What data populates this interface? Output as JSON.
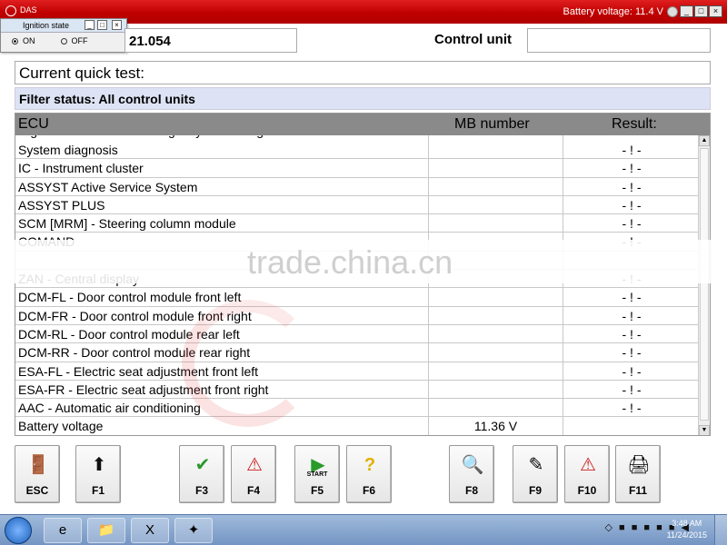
{
  "window": {
    "battery_label": "Battery voltage: 11.4 V",
    "min": "_",
    "max": "□",
    "close": "×"
  },
  "ignition": {
    "title": "Ignition state",
    "on_label": "ON",
    "off_label": "OFF",
    "selected": "ON"
  },
  "header": {
    "vehicle_value": "21.054",
    "control_unit_label": "Control unit",
    "control_unit_value": ""
  },
  "quick_test": "Current quick test:",
  "filter_status": "Filter status: All control units",
  "table": {
    "columns": [
      "ECU",
      "MB number",
      "Result:"
    ],
    "partial_top_row": "Right front reversible emergency tensioning retractor",
    "rows": [
      {
        "ecu": "System diagnosis",
        "mb": "",
        "result": "- ! -"
      },
      {
        "ecu": "IC - Instrument cluster",
        "mb": "",
        "result": "- ! -"
      },
      {
        "ecu": "ASSYST Active Service System",
        "mb": "",
        "result": "- ! -"
      },
      {
        "ecu": "ASSYST PLUS",
        "mb": "",
        "result": "- ! -"
      },
      {
        "ecu": "SCM [MRM] - Steering column module",
        "mb": "",
        "result": "- ! -"
      },
      {
        "ecu": "COMAND",
        "mb": "",
        "result": "- ! -"
      },
      {
        "ecu": "",
        "mb": "",
        "result": ""
      },
      {
        "ecu": "ZAN - Central display",
        "mb": "",
        "result": "- ! -"
      },
      {
        "ecu": "DCM-FL - Door control module front left",
        "mb": "",
        "result": "- ! -"
      },
      {
        "ecu": "DCM-FR - Door control module front right",
        "mb": "",
        "result": "- ! -"
      },
      {
        "ecu": "DCM-RL - Door control module rear left",
        "mb": "",
        "result": "- ! -"
      },
      {
        "ecu": "DCM-RR - Door control module rear right",
        "mb": "",
        "result": "- ! -"
      },
      {
        "ecu": "ESA-FL - Electric seat adjustment front left",
        "mb": "",
        "result": "- ! -"
      },
      {
        "ecu": "ESA-FR - Electric seat adjustment front right",
        "mb": "",
        "result": "- ! -"
      },
      {
        "ecu": "AAC - Automatic air conditioning",
        "mb": "",
        "result": "- ! -"
      },
      {
        "ecu": "Battery voltage",
        "mb": "11.36 V",
        "result": ""
      }
    ]
  },
  "watermark": "trade.china.cn",
  "fkeys": [
    {
      "label": "ESC",
      "icon": "exit-door-icon",
      "glyph": "🚪"
    },
    {
      "label": "F1",
      "icon": "arrow-up-icon",
      "glyph": "⬆"
    },
    {
      "label": "F3",
      "icon": "checkmark-icon",
      "glyph": "✔"
    },
    {
      "label": "F4",
      "icon": "ecu-warning-icon",
      "glyph": "⚠"
    },
    {
      "label": "F5",
      "icon": "start-play-icon",
      "glyph": "▶",
      "sub": "START"
    },
    {
      "label": "F6",
      "icon": "help-question-icon",
      "glyph": "?"
    },
    {
      "label": "F8",
      "icon": "magnifier-icon",
      "glyph": "🔍"
    },
    {
      "label": "F9",
      "icon": "edit-pencil-icon",
      "glyph": "✎"
    },
    {
      "label": "F10",
      "icon": "ecu-alert-icon",
      "glyph": "⚠"
    },
    {
      "label": "F11",
      "icon": "printer-icon",
      "glyph": "🖨"
    }
  ],
  "taskbar": {
    "items": [
      "e",
      "📁",
      "X",
      "✦"
    ],
    "tray": "◇ ■ ■ ■ ■ ■ ◀",
    "time": "3:48 AM",
    "date": "11/24/2015"
  }
}
